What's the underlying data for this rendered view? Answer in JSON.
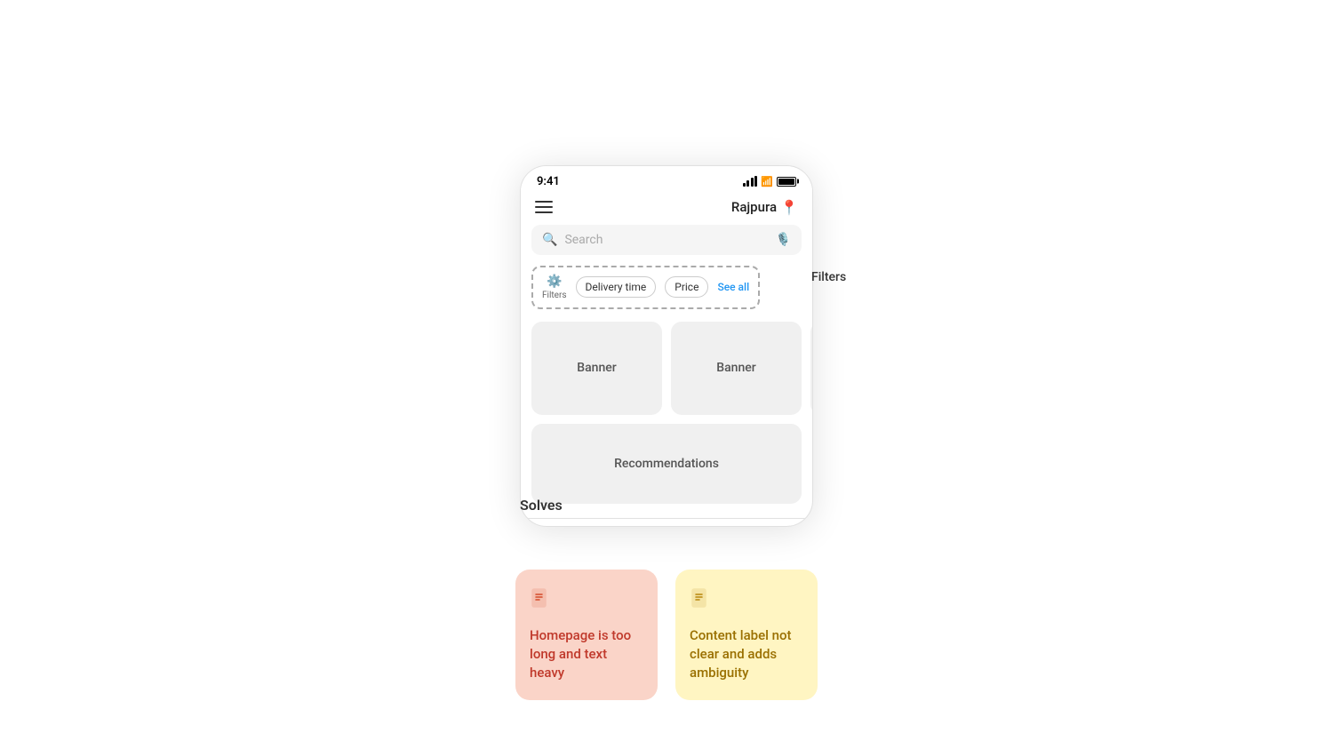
{
  "phone": {
    "status_bar": {
      "time": "9:41",
      "signal_alt": "signal bars",
      "wifi_alt": "wifi",
      "battery_alt": "battery"
    },
    "header": {
      "location": "Rajpura",
      "hamburger_alt": "menu",
      "pin_alt": "location pin"
    },
    "search": {
      "placeholder": "Search"
    },
    "filters": {
      "label": "Filters",
      "outside_label": "Filters",
      "chips": [
        "Delivery time",
        "Price"
      ],
      "see_all": "See all"
    },
    "banners": [
      "Banner",
      "Banner"
    ],
    "recommendations": "Recommendations"
  },
  "solves": {
    "label": "Solves"
  },
  "issue_cards": [
    {
      "id": "homepage-long",
      "icon": "📋",
      "text": "Homepage is too long and text heavy",
      "color": "red"
    },
    {
      "id": "content-label",
      "icon": "📋",
      "text": "Content label not clear and adds ambiguity",
      "color": "yellow"
    }
  ]
}
